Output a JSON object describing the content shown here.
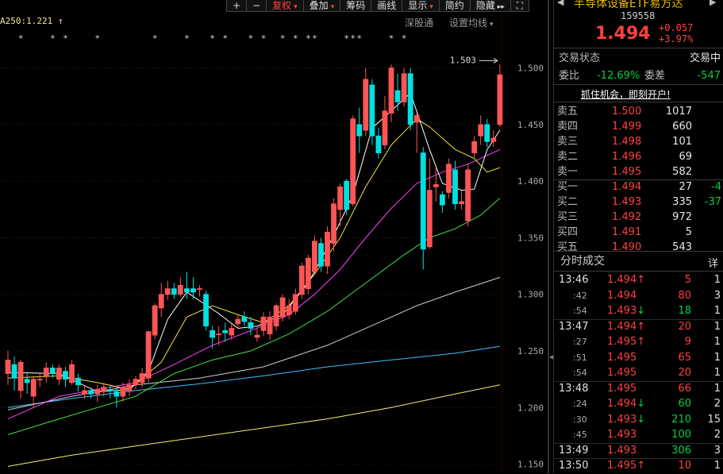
{
  "toolbar": {
    "items": [
      {
        "label": "+",
        "active": false
      },
      {
        "label": "−",
        "active": false
      },
      {
        "label": "复权",
        "active": true,
        "caret": true
      },
      {
        "label": "叠加",
        "active": false,
        "caret": true
      },
      {
        "label": "筹码",
        "active": false
      },
      {
        "label": "画线",
        "active": false
      },
      {
        "label": "显示",
        "active": false,
        "caret": true
      },
      {
        "label": "简约",
        "active": false
      },
      {
        "label": "隐藏",
        "active": false,
        "glyph": "▸▸"
      },
      {
        "label": "⛶",
        "active": false
      }
    ]
  },
  "chart_header": {
    "ma250_label": "A250:1.221",
    "shenzhen_link": "深股通",
    "set_ma": "设置均线"
  },
  "chart_data": {
    "type": "candlestick",
    "y_ticks": [
      "1.500",
      "1.450",
      "1.400",
      "1.350",
      "1.300",
      "1.250",
      "1.200",
      "1.150"
    ],
    "ylim": [
      1.142,
      1.532
    ],
    "max_label": "1.503",
    "colors": {
      "up": "#ff5555",
      "down": "#00e0e0",
      "ma5": "#ffffff",
      "ma10": "#f0e040",
      "ma20": "#ff40ff",
      "ma30": "#40e040",
      "ma60": "#d0d0d0",
      "ma120": "#40c0ff",
      "ma250": "#f0f070"
    },
    "candles": [
      {
        "o": 1.23,
        "c": 1.242,
        "h": 1.25,
        "l": 1.22
      },
      {
        "o": 1.238,
        "c": 1.226,
        "h": 1.245,
        "l": 1.215
      },
      {
        "o": 1.215,
        "c": 1.24,
        "h": 1.242,
        "l": 1.208
      },
      {
        "o": 1.225,
        "c": 1.222,
        "h": 1.23,
        "l": 1.212
      },
      {
        "o": 1.21,
        "c": 1.225,
        "h": 1.228,
        "l": 1.2
      },
      {
        "o": 1.225,
        "c": 1.225,
        "h": 1.23,
        "l": 1.218
      },
      {
        "o": 1.228,
        "c": 1.235,
        "h": 1.24,
        "l": 1.222
      },
      {
        "o": 1.235,
        "c": 1.23,
        "h": 1.238,
        "l": 1.226
      },
      {
        "o": 1.225,
        "c": 1.235,
        "h": 1.238,
        "l": 1.22
      },
      {
        "o": 1.232,
        "c": 1.225,
        "h": 1.236,
        "l": 1.218
      },
      {
        "o": 1.222,
        "c": 1.238,
        "h": 1.242,
        "l": 1.22
      },
      {
        "o": 1.226,
        "c": 1.22,
        "h": 1.23,
        "l": 1.214
      },
      {
        "o": 1.212,
        "c": 1.215,
        "h": 1.22,
        "l": 1.208
      },
      {
        "o": 1.215,
        "c": 1.212,
        "h": 1.218,
        "l": 1.208
      },
      {
        "o": 1.212,
        "c": 1.216,
        "h": 1.22,
        "l": 1.205
      },
      {
        "o": 1.214,
        "c": 1.218,
        "h": 1.222,
        "l": 1.21
      },
      {
        "o": 1.216,
        "c": 1.215,
        "h": 1.22,
        "l": 1.208
      },
      {
        "o": 1.214,
        "c": 1.21,
        "h": 1.218,
        "l": 1.2
      },
      {
        "o": 1.21,
        "c": 1.218,
        "h": 1.222,
        "l": 1.205
      },
      {
        "o": 1.215,
        "c": 1.22,
        "h": 1.225,
        "l": 1.21
      },
      {
        "o": 1.22,
        "c": 1.225,
        "h": 1.228,
        "l": 1.216
      },
      {
        "o": 1.222,
        "c": 1.23,
        "h": 1.235,
        "l": 1.218
      },
      {
        "o": 1.226,
        "c": 1.267,
        "h": 1.268,
        "l": 1.222
      },
      {
        "o": 1.264,
        "c": 1.29,
        "h": 1.292,
        "l": 1.26
      },
      {
        "o": 1.288,
        "c": 1.3,
        "h": 1.31,
        "l": 1.28
      },
      {
        "o": 1.3,
        "c": 1.305,
        "h": 1.312,
        "l": 1.295
      },
      {
        "o": 1.305,
        "c": 1.3,
        "h": 1.31,
        "l": 1.296
      },
      {
        "o": 1.3,
        "c": 1.308,
        "h": 1.315,
        "l": 1.298
      },
      {
        "o": 1.305,
        "c": 1.302,
        "h": 1.32,
        "l": 1.296
      },
      {
        "o": 1.305,
        "c": 1.302,
        "h": 1.315,
        "l": 1.296
      },
      {
        "o": 1.305,
        "c": 1.305,
        "h": 1.308,
        "l": 1.298
      },
      {
        "o": 1.3,
        "c": 1.272,
        "h": 1.303,
        "l": 1.268
      },
      {
        "o": 1.268,
        "c": 1.262,
        "h": 1.272,
        "l": 1.252
      },
      {
        "o": 1.265,
        "c": 1.265,
        "h": 1.272,
        "l": 1.255
      },
      {
        "o": 1.268,
        "c": 1.266,
        "h": 1.275,
        "l": 1.258
      },
      {
        "o": 1.264,
        "c": 1.27,
        "h": 1.274,
        "l": 1.26
      },
      {
        "o": 1.274,
        "c": 1.278,
        "h": 1.282,
        "l": 1.27
      },
      {
        "o": 1.28,
        "c": 1.276,
        "h": 1.285,
        "l": 1.272
      },
      {
        "o": 1.275,
        "c": 1.27,
        "h": 1.28,
        "l": 1.264
      },
      {
        "o": 1.262,
        "c": 1.264,
        "h": 1.27,
        "l": 1.258
      },
      {
        "o": 1.268,
        "c": 1.28,
        "h": 1.284,
        "l": 1.263
      },
      {
        "o": 1.265,
        "c": 1.28,
        "h": 1.285,
        "l": 1.26
      },
      {
        "o": 1.272,
        "c": 1.29,
        "h": 1.292,
        "l": 1.268
      },
      {
        "o": 1.28,
        "c": 1.297,
        "h": 1.3,
        "l": 1.276
      },
      {
        "o": 1.282,
        "c": 1.29,
        "h": 1.296,
        "l": 1.278
      },
      {
        "o": 1.285,
        "c": 1.3,
        "h": 1.305,
        "l": 1.282
      },
      {
        "o": 1.3,
        "c": 1.325,
        "h": 1.328,
        "l": 1.296
      },
      {
        "o": 1.305,
        "c": 1.332,
        "h": 1.335,
        "l": 1.3
      },
      {
        "o": 1.32,
        "c": 1.347,
        "h": 1.352,
        "l": 1.318
      },
      {
        "o": 1.345,
        "c": 1.325,
        "h": 1.35,
        "l": 1.32
      },
      {
        "o": 1.325,
        "c": 1.355,
        "h": 1.36,
        "l": 1.318
      },
      {
        "o": 1.345,
        "c": 1.38,
        "h": 1.385,
        "l": 1.338
      },
      {
        "o": 1.375,
        "c": 1.395,
        "h": 1.398,
        "l": 1.36
      },
      {
        "o": 1.4,
        "c": 1.375,
        "h": 1.402,
        "l": 1.37
      },
      {
        "o": 1.38,
        "c": 1.455,
        "h": 1.458,
        "l": 1.378
      },
      {
        "o": 1.45,
        "c": 1.44,
        "h": 1.465,
        "l": 1.425
      },
      {
        "o": 1.445,
        "c": 1.49,
        "h": 1.5,
        "l": 1.44
      },
      {
        "o": 1.485,
        "c": 1.44,
        "h": 1.49,
        "l": 1.432
      },
      {
        "o": 1.44,
        "c": 1.425,
        "h": 1.447,
        "l": 1.42
      },
      {
        "o": 1.432,
        "c": 1.462,
        "h": 1.475,
        "l": 1.428
      },
      {
        "o": 1.46,
        "c": 1.5,
        "h": 1.503,
        "l": 1.452
      },
      {
        "o": 1.48,
        "c": 1.47,
        "h": 1.495,
        "l": 1.462
      },
      {
        "o": 1.47,
        "c": 1.495,
        "h": 1.5,
        "l": 1.466
      },
      {
        "o": 1.495,
        "c": 1.45,
        "h": 1.5,
        "l": 1.445
      },
      {
        "o": 1.452,
        "c": 1.458,
        "h": 1.46,
        "l": 1.425
      },
      {
        "o": 1.425,
        "c": 1.34,
        "h": 1.43,
        "l": 1.322
      },
      {
        "o": 1.342,
        "c": 1.392,
        "h": 1.42,
        "l": 1.34
      },
      {
        "o": 1.395,
        "c": 1.397,
        "h": 1.412,
        "l": 1.382
      },
      {
        "o": 1.388,
        "c": 1.379,
        "h": 1.391,
        "l": 1.372
      },
      {
        "o": 1.39,
        "c": 1.415,
        "h": 1.42,
        "l": 1.385
      },
      {
        "o": 1.41,
        "c": 1.38,
        "h": 1.418,
        "l": 1.375
      },
      {
        "o": 1.38,
        "c": 1.382,
        "h": 1.392,
        "l": 1.375
      },
      {
        "o": 1.365,
        "c": 1.41,
        "h": 1.415,
        "l": 1.36
      },
      {
        "o": 1.425,
        "c": 1.435,
        "h": 1.44,
        "l": 1.42
      },
      {
        "o": 1.44,
        "c": 1.45,
        "h": 1.458,
        "l": 1.432
      },
      {
        "o": 1.45,
        "c": 1.435,
        "h": 1.455,
        "l": 1.43
      },
      {
        "o": 1.435,
        "c": 1.438,
        "h": 1.445,
        "l": 1.43
      },
      {
        "o": 1.45,
        "c": 1.494,
        "h": 1.503,
        "l": 1.448
      }
    ],
    "ma": {
      "ma5": [
        [
          0,
          1.231
        ],
        [
          8,
          1.23
        ],
        [
          14,
          1.214
        ],
        [
          19,
          1.216
        ],
        [
          22,
          1.232
        ],
        [
          25,
          1.278
        ],
        [
          28,
          1.302
        ],
        [
          33,
          1.283
        ],
        [
          36,
          1.27
        ],
        [
          39,
          1.272
        ],
        [
          43,
          1.282
        ],
        [
          47,
          1.31
        ],
        [
          51,
          1.352
        ],
        [
          54,
          1.388
        ],
        [
          57,
          1.447
        ],
        [
          60,
          1.462
        ],
        [
          63,
          1.478
        ],
        [
          66,
          1.428
        ],
        [
          68,
          1.398
        ],
        [
          71,
          1.392
        ],
        [
          73,
          1.393
        ],
        [
          75,
          1.428
        ],
        [
          77,
          1.445
        ]
      ],
      "ma10": [
        [
          0,
          1.226
        ],
        [
          8,
          1.228
        ],
        [
          14,
          1.222
        ],
        [
          19,
          1.216
        ],
        [
          24,
          1.24
        ],
        [
          28,
          1.28
        ],
        [
          32,
          1.29
        ],
        [
          36,
          1.282
        ],
        [
          40,
          1.275
        ],
        [
          44,
          1.29
        ],
        [
          48,
          1.318
        ],
        [
          52,
          1.35
        ],
        [
          56,
          1.395
        ],
        [
          60,
          1.432
        ],
        [
          64,
          1.455
        ],
        [
          66,
          1.448
        ],
        [
          70,
          1.428
        ],
        [
          73,
          1.42
        ],
        [
          75,
          1.408
        ],
        [
          77,
          1.412
        ]
      ],
      "ma20": [
        [
          0,
          1.19
        ],
        [
          8,
          1.21
        ],
        [
          14,
          1.216
        ],
        [
          20,
          1.222
        ],
        [
          26,
          1.238
        ],
        [
          32,
          1.255
        ],
        [
          38,
          1.268
        ],
        [
          44,
          1.282
        ],
        [
          48,
          1.3
        ],
        [
          52,
          1.322
        ],
        [
          56,
          1.35
        ],
        [
          60,
          1.376
        ],
        [
          64,
          1.398
        ],
        [
          68,
          1.408
        ],
        [
          72,
          1.415
        ],
        [
          77,
          1.428
        ]
      ],
      "ma30": [
        [
          0,
          1.176
        ],
        [
          8,
          1.19
        ],
        [
          14,
          1.2
        ],
        [
          20,
          1.21
        ],
        [
          26,
          1.23
        ],
        [
          32,
          1.242
        ],
        [
          38,
          1.25
        ],
        [
          44,
          1.265
        ],
        [
          50,
          1.285
        ],
        [
          56,
          1.31
        ],
        [
          62,
          1.335
        ],
        [
          66,
          1.35
        ],
        [
          70,
          1.358
        ],
        [
          74,
          1.37
        ],
        [
          77,
          1.385
        ]
      ],
      "ma60": [
        [
          0,
          1.198
        ],
        [
          10,
          1.21
        ],
        [
          20,
          1.22
        ],
        [
          30,
          1.226
        ],
        [
          40,
          1.236
        ],
        [
          50,
          1.255
        ],
        [
          58,
          1.275
        ],
        [
          64,
          1.29
        ],
        [
          70,
          1.302
        ],
        [
          77,
          1.315
        ]
      ],
      "ma120": [
        [
          0,
          1.2
        ],
        [
          10,
          1.208
        ],
        [
          20,
          1.215
        ],
        [
          30,
          1.221
        ],
        [
          40,
          1.228
        ],
        [
          50,
          1.236
        ],
        [
          60,
          1.242
        ],
        [
          70,
          1.248
        ],
        [
          77,
          1.254
        ]
      ],
      "ma250": [
        [
          0,
          1.148
        ],
        [
          10,
          1.158
        ],
        [
          20,
          1.166
        ],
        [
          30,
          1.174
        ],
        [
          40,
          1.182
        ],
        [
          50,
          1.19
        ],
        [
          60,
          1.2
        ],
        [
          70,
          1.212
        ],
        [
          77,
          1.22
        ]
      ]
    },
    "marker_indices": [
      2,
      7,
      9,
      14,
      23,
      28,
      32,
      34,
      38,
      40,
      43,
      45,
      47,
      48,
      53,
      54,
      55,
      60,
      62
    ]
  },
  "quote": {
    "title": "半导体设备ETF易方达",
    "code": "159558",
    "price": "1.494",
    "change": "+0.057",
    "change_pct": "+3.97%",
    "status_label": "交易状态",
    "status_value": "交易中",
    "weibi_label": "委比",
    "weibi_value": "-12.69%",
    "weicha_label": "委差",
    "weicha_value": "-547",
    "banner": "抓住机会，即刻开户!",
    "asks": [
      {
        "label": "卖五",
        "price": "1.500",
        "vol": "1017",
        "delta": ""
      },
      {
        "label": "卖四",
        "price": "1.499",
        "vol": "660",
        "delta": ""
      },
      {
        "label": "卖三",
        "price": "1.498",
        "vol": "101",
        "delta": ""
      },
      {
        "label": "卖二",
        "price": "1.496",
        "vol": "69",
        "delta": ""
      },
      {
        "label": "卖一",
        "price": "1.495",
        "vol": "582",
        "delta": ""
      }
    ],
    "bids": [
      {
        "label": "买一",
        "price": "1.494",
        "vol": "27",
        "delta": "-4"
      },
      {
        "label": "买二",
        "price": "1.493",
        "vol": "335",
        "delta": "-37"
      },
      {
        "label": "买三",
        "price": "1.492",
        "vol": "972",
        "delta": ""
      },
      {
        "label": "买四",
        "price": "1.491",
        "vol": "5",
        "delta": ""
      },
      {
        "label": "买五",
        "price": "1.490",
        "vol": "543",
        "delta": ""
      }
    ],
    "trades_title": "分时成交",
    "trades_detail": "详",
    "trades": [
      {
        "time": "13:46",
        "full": true,
        "price": "1.494",
        "dir": "up",
        "vol": "5",
        "vcolor": "red",
        "num": "1"
      },
      {
        "time": ":42",
        "full": false,
        "price": "1.494",
        "dir": "",
        "vol": "80",
        "vcolor": "red",
        "num": "3"
      },
      {
        "time": ":54",
        "full": false,
        "price": "1.493",
        "dir": "down",
        "vol": "18",
        "vcolor": "green",
        "num": "1"
      },
      {
        "time": "13:47",
        "full": true,
        "price": "1.494",
        "dir": "up",
        "vol": "20",
        "vcolor": "red",
        "num": "1"
      },
      {
        "time": ":27",
        "full": false,
        "price": "1.495",
        "dir": "up",
        "vol": "9",
        "vcolor": "red",
        "num": "1"
      },
      {
        "time": ":51",
        "full": false,
        "price": "1.495",
        "dir": "",
        "vol": "65",
        "vcolor": "red",
        "num": "1"
      },
      {
        "time": ":54",
        "full": false,
        "price": "1.495",
        "dir": "",
        "vol": "20",
        "vcolor": "red",
        "num": "1"
      },
      {
        "time": "13:48",
        "full": true,
        "price": "1.495",
        "dir": "",
        "vol": "66",
        "vcolor": "red",
        "num": "1"
      },
      {
        "time": ":24",
        "full": false,
        "price": "1.494",
        "dir": "down",
        "vol": "60",
        "vcolor": "green",
        "num": "2"
      },
      {
        "time": ":30",
        "full": false,
        "price": "1.493",
        "dir": "down",
        "vol": "210",
        "vcolor": "green",
        "num": "15"
      },
      {
        "time": ":45",
        "full": false,
        "price": "1.493",
        "dir": "",
        "vol": "100",
        "vcolor": "green",
        "num": "2"
      },
      {
        "time": "13:49",
        "full": true,
        "price": "1.493",
        "dir": "",
        "vol": "306",
        "vcolor": "green",
        "num": "3"
      },
      {
        "time": "13:50",
        "full": true,
        "price": "1.495",
        "dir": "up",
        "vol": "10",
        "vcolor": "red",
        "num": "1"
      }
    ]
  }
}
